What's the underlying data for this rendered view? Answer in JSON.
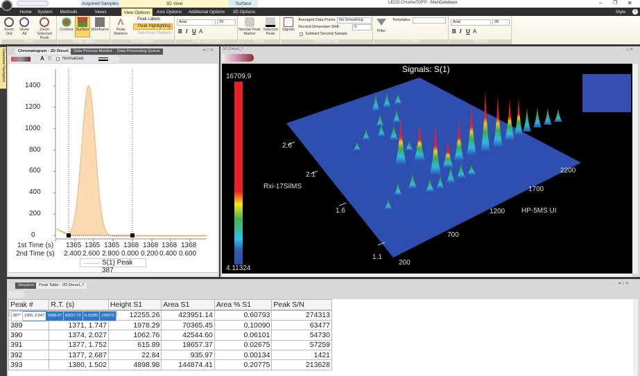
{
  "app": {
    "title": "LECO ChromaTOF® - MainDatabase",
    "style_label": "Style",
    "context_tabs": [
      "Acquired Samples",
      "3D View",
      "Surface"
    ]
  },
  "ribbon_tabs": [
    "Home",
    "System",
    "Methods",
    "Views",
    "View Options",
    "Axis Options",
    "Additional Options",
    "3D Options"
  ],
  "ribbon": {
    "zoom": {
      "label": "Zoom",
      "zoom_out": "Zoom Out",
      "show_all": "Show All",
      "zoom_selected_peak": "Zoom Selected Peak"
    },
    "graph_types": {
      "label": "Graph Types",
      "contour": "Contour",
      "surface": "Surface",
      "wireframe": "Wireframe"
    },
    "peak_options": {
      "label": "Peak Options",
      "peak_markers": "Peak Markers",
      "peak_labels": "Peak Labels",
      "peak_highlighting": "Peak Highlighting",
      "sub_peak_markers": "Sub-Peak Markers"
    },
    "peak_label_font": {
      "label": "Peak Label Font",
      "font": "Arial",
      "size": "20"
    },
    "colors": {
      "label": "Colors",
      "normal_peak_marker": "Normal Peak Marker",
      "selected_peak": "Selected Peak"
    },
    "displayed_data": {
      "label": "Displayed Data",
      "signals": "Signals",
      "averaged_label": "Averaged Data Points:",
      "averaged_value": "No Smoothing",
      "shift_label": "Second Dimension Shift:",
      "shift_value": "0",
      "subtract": "Subtract Second Sample"
    },
    "peak_filters": {
      "label": "Peak Filters",
      "filter": "Filter",
      "templates": "Templates:",
      "templates_value": ""
    },
    "title_font": {
      "label": "Title Font",
      "font": "Arial",
      "size": "28"
    }
  },
  "side_tab": "Database Navigator",
  "chromatogram": {
    "tabs": [
      "Chromatogram - 2D Diesel_7",
      "Data Process Monitor",
      "Data Processing Queue"
    ],
    "normalized": "Normalized",
    "chart_data": {
      "type": "area",
      "y_ticks": [
        "1400",
        "1200",
        "1000",
        "800",
        "600",
        "400",
        "200",
        "0"
      ],
      "ylim": [
        0,
        1400
      ],
      "x_row1_label": "1st Time (s)",
      "x_row2_label": "2nd Time (s)",
      "x_row1": [
        "1365",
        "1365",
        "1365",
        "1368",
        "1368",
        "1368",
        "1368"
      ],
      "x_row2": [
        "2.400",
        "2.600",
        "2.800",
        "0.000",
        "0.200",
        "0.400",
        "0.600"
      ],
      "series": [
        {
          "name": "S(1) Peak 387",
          "apex": 1410
        }
      ],
      "legend": "bottom"
    }
  },
  "view3d": {
    "tab": "2D Diesel_7",
    "title": "Signals:  S(1)",
    "colorbar": {
      "max": "16709.9",
      "min": "4.11324"
    },
    "y_axis_label": "Rxi-17SilMS",
    "y_ticks": [
      "2.6",
      "2.1",
      "1.6",
      "1.1"
    ],
    "x_axis_label": "HP-5MS UI",
    "x_ticks": [
      "200",
      "700",
      "1200",
      "1700",
      "2200"
    ]
  },
  "peak_table": {
    "tabs": [
      "Structure",
      "Peak Table - 2D Diesel_7"
    ],
    "columns": [
      "Peak #",
      "R.T. (s)",
      "Height S1",
      "Area S1",
      "Area % S1",
      "Peak S/N"
    ],
    "rows": [
      [
        "387*",
        "1365, 2.547",
        "2588.47",
        "83227.72",
        "0.11935",
        "130273"
      ],
      [
        "388",
        "1368, 1.532",
        "12255.26",
        "423951.14",
        "0.60793",
        "274313"
      ],
      [
        "389",
        "1371, 1.747",
        "1978.29",
        "70365.45",
        "0.10090",
        "63477"
      ],
      [
        "390",
        "1374, 2.027",
        "1062.76",
        "42544.60",
        "0.06101",
        "54730"
      ],
      [
        "391",
        "1377, 1.752",
        "615.89",
        "18657.37",
        "0.02675",
        "57259"
      ],
      [
        "392",
        "1377, 2.687",
        "22.84",
        "935.97",
        "0.00134",
        "1421"
      ],
      [
        "393",
        "1380, 1.502",
        "4898.98",
        "144874.41",
        "0.20775",
        "213628"
      ]
    ]
  }
}
